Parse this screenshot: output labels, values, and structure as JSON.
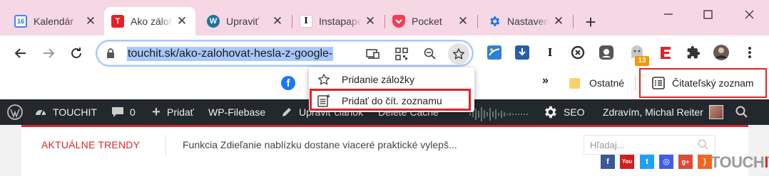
{
  "tabs": [
    {
      "title": "Kalendár",
      "favicon": "google-calendar-icon",
      "active": false
    },
    {
      "title": "Ako zálohovať",
      "favicon": "touchit-icon",
      "active": true
    },
    {
      "title": "Upraviť",
      "favicon": "wordpress-icon",
      "active": false
    },
    {
      "title": "Instapaper",
      "favicon": "instapaper-icon",
      "active": false
    },
    {
      "title": "Pocket",
      "favicon": "pocket-icon",
      "active": false
    },
    {
      "title": "Nastavenia",
      "favicon": "settings-gear-icon",
      "active": false
    }
  ],
  "new_tab": "+",
  "window_controls": [
    "minimize-icon",
    "maximize-icon",
    "close-icon"
  ],
  "omnibox": {
    "url": "touchit.sk/ako-zalohovat-hesla-z-google-",
    "icons": [
      "lock-icon",
      "install-app-icon",
      "qr-code-icon",
      "zoom-out-icon",
      "star-icon"
    ]
  },
  "extensions": {
    "badge_count": "13",
    "icons": [
      "reading-extension-icon",
      "pocket-download-icon",
      "instapaper-ext-icon",
      "block-icon",
      "bitwarden-icon",
      "ghost-icon",
      "evernote-icon",
      "puzzle-icon",
      "profile-avatar-icon",
      "kebab-menu-icon"
    ]
  },
  "bookmarks_bar": {
    "more": "»",
    "other": "Ostatné",
    "reading_list": "Čitateľský zoznam"
  },
  "bookmark_menu": {
    "items": [
      {
        "label": "Pridanie záložky",
        "icon": "star-outline-icon"
      },
      {
        "label": "Pridať do čít. zoznamu",
        "icon": "reading-list-add-icon"
      }
    ]
  },
  "wp_admin_bar": {
    "site_name": "TOUCHIT",
    "comments_count": "0",
    "new_label": "Pridať",
    "filebase": "WP-Filebase",
    "edit_article": "Upraviť článok",
    "delete_cache": "Delete Cache",
    "seo": "SEO",
    "greeting": "Zdravím, Michal Reiter"
  },
  "page": {
    "trending_label": "AKTUÁLNE TRENDY",
    "trending_text": "Funkcia Zdieľanie nablízku dostane viaceré praktické vylepš...",
    "search_placeholder": "Hľadaj...",
    "social": [
      "facebook-icon",
      "youtube-icon",
      "twitter-icon",
      "instagram-icon",
      "google-plus-icon",
      "rss-icon"
    ],
    "logo_text_a": "TOUCH",
    "logo_text_b": "IT"
  },
  "colors": {
    "tabstrip": "#f6d7e4",
    "highlight_red": "#e5202a",
    "wp_bar": "#23282d",
    "accent_red": "#d9272e",
    "url_selection": "#a8c7fa"
  }
}
